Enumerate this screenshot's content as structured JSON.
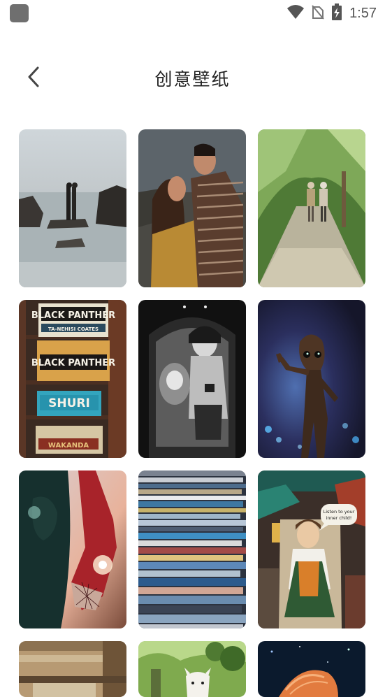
{
  "status_bar": {
    "time": "1:57",
    "icons": [
      "app-indicator-icon",
      "wifi-icon",
      "no-sim-icon",
      "battery-charging-icon"
    ]
  },
  "header": {
    "back_icon": "chevron-left-icon",
    "title": "创意壁纸"
  },
  "wallpapers": {
    "items": [
      {
        "name": "wallpaper-couple-on-rocks",
        "comic_lines": []
      },
      {
        "name": "wallpaper-couple-kiss-forehead",
        "comic_lines": []
      },
      {
        "name": "wallpaper-elderly-couple-walking",
        "comic_lines": []
      },
      {
        "name": "wallpaper-comic-books",
        "comic_lines": [
          "BLACK PANTHER",
          "TA-NEHISI COATES",
          "BLACK PANTHER",
          "SHURI",
          "WAKANDA"
        ]
      },
      {
        "name": "wallpaper-mural-black-white",
        "comic_lines": []
      },
      {
        "name": "wallpaper-groot-figure",
        "comic_lines": []
      },
      {
        "name": "wallpaper-spiderman-glove",
        "comic_lines": []
      },
      {
        "name": "wallpaper-stacked-magazines",
        "comic_lines": []
      },
      {
        "name": "wallpaper-street-art-woman",
        "comic_lines": [
          "Listen to your",
          "inner child!"
        ]
      },
      {
        "name": "wallpaper-old-building",
        "comic_lines": []
      },
      {
        "name": "wallpaper-alpaca",
        "comic_lines": []
      },
      {
        "name": "wallpaper-jellyfish",
        "comic_lines": []
      }
    ]
  },
  "colors": {
    "title": "#222222",
    "status_icons": "#555555"
  }
}
